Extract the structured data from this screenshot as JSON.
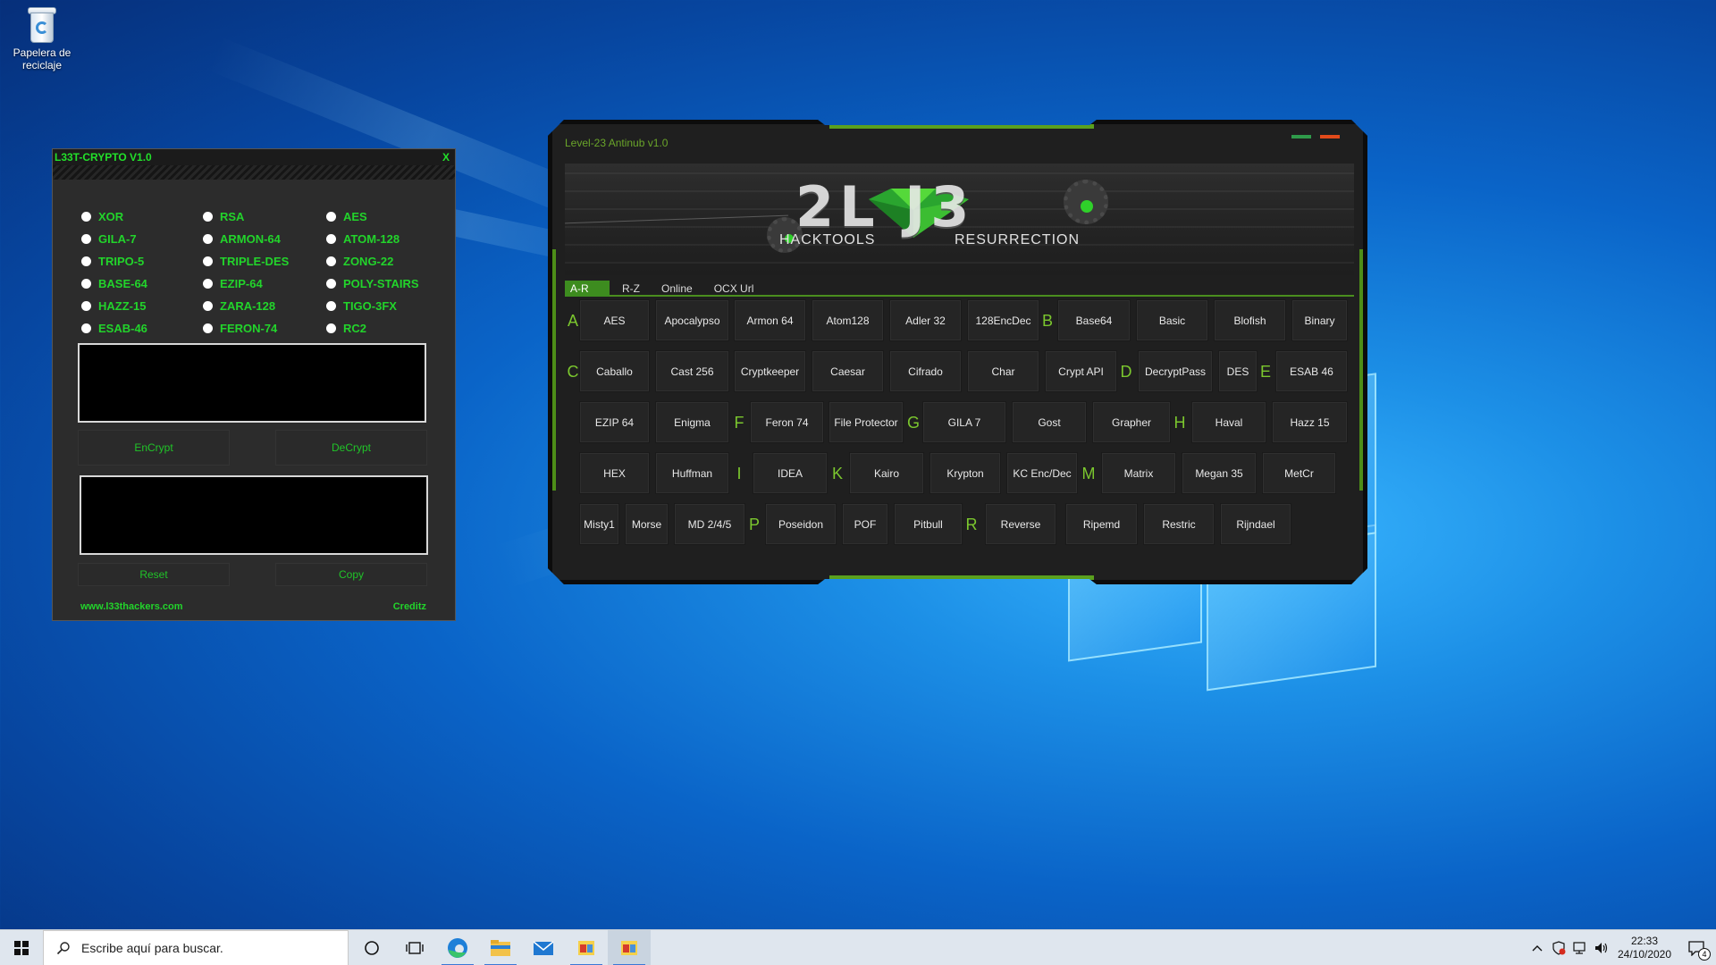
{
  "desktop": {
    "recycle_bin_label": "Papelera de reciclaje"
  },
  "crypto_window": {
    "title": "L33T-CRYPTO V1.0",
    "close_label": "X",
    "options": [
      "XOR",
      "RSA",
      "AES",
      "GILA-7",
      "ARMON-64",
      "ATOM-128",
      "TRIPO-5",
      "TRIPLE-DES",
      "ZONG-22",
      "BASE-64",
      "EZIP-64",
      "POLY-STAIRS",
      "HAZZ-15",
      "ZARA-128",
      "TIGO-3FX",
      "ESAB-46",
      "FERON-74",
      "RC2"
    ],
    "encrypt_label": "EnCrypt",
    "decrypt_label": "DeCrypt",
    "reset_label": "Reset",
    "copy_label": "Copy",
    "website": "www.l33thackers.com",
    "credits": "Creditz",
    "accent_color": "#22d42b"
  },
  "level23_window": {
    "title": "Level-23 Antinub v1.0",
    "banner": {
      "logo_text": "2L J3",
      "left_caption": "HACKTOOLS",
      "right_caption": "RESURRECTION"
    },
    "tabs": [
      "A-R",
      "R-Z",
      "Online",
      "OCX Url"
    ],
    "active_tab": "A-R",
    "rows": [
      {
        "letter_a": "A",
        "items": [
          "AES",
          "Apocalypso",
          "Armon 64",
          "Atom128",
          "Adler 32",
          "128EncDec"
        ],
        "letter_b": "B",
        "items_b": [
          "Base64",
          "Basic",
          "Blofish",
          "Binary"
        ]
      },
      {
        "letter_a": "C",
        "items": [
          "Caballo",
          "Cast 256",
          "Cryptkeeper",
          "Caesar",
          "Cifrado",
          "Char",
          "Crypt API"
        ],
        "letter_b": "D",
        "items_b": [
          "DecryptPass",
          "DES"
        ],
        "letter_c": "E",
        "items_c": [
          "ESAB 46"
        ]
      },
      {
        "items": [
          "EZIP 64",
          "Enigma"
        ],
        "letter_b": "F",
        "items_b": [
          "Feron 74",
          "File Protector"
        ],
        "letter_c": "G",
        "items_c": [
          "GILA 7",
          "Gost",
          "Grapher"
        ],
        "letter_d": "H",
        "items_d": [
          "Haval",
          "Hazz 15"
        ]
      },
      {
        "items": [
          "HEX",
          "Huffman"
        ],
        "letter_b": "I",
        "items_b": [
          "IDEA"
        ],
        "letter_c": "K",
        "items_c": [
          "Kairo",
          "Krypton",
          "KC Enc/Dec"
        ],
        "letter_d": "M",
        "items_d": [
          "Matrix",
          "Megan 35",
          "MetCr"
        ]
      },
      {
        "items": [
          "Misty1",
          "Morse",
          "MD 2/4/5"
        ],
        "letter_b": "P",
        "items_b": [
          "Poseidon",
          "POF",
          "Pitbull"
        ],
        "letter_c": "R",
        "items_c": [
          "Reverse",
          "Ripemd",
          "Restric",
          "Rijndael"
        ]
      }
    ],
    "accent_color": "#7bc72e"
  },
  "taskbar": {
    "search_placeholder": "Escribe aquí para buscar.",
    "time": "22:33",
    "date": "24/10/2020",
    "notification_count": "4"
  }
}
